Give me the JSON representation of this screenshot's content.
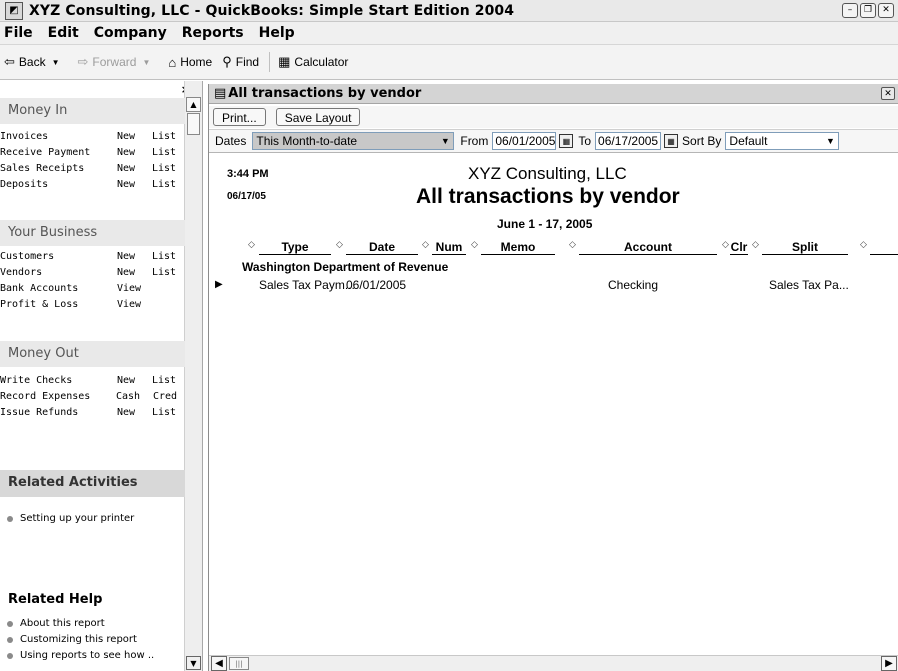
{
  "window": {
    "title": "XYZ Consulting, LLC - QuickBooks: Simple Start Edition 2004"
  },
  "menu": [
    "File",
    "Edit",
    "Company",
    "Reports",
    "Help"
  ],
  "toolbar": {
    "back": "Back",
    "forward": "Forward",
    "home": "Home",
    "find": "Find",
    "calculator": "Calculator"
  },
  "navigator": {
    "money_in": {
      "title": "Money In",
      "rows": [
        {
          "name": "Invoices",
          "a1": "New",
          "a2": "List"
        },
        {
          "name": "Receive Payment",
          "a1": "New",
          "a2": "List"
        },
        {
          "name": "Sales Receipts",
          "a1": "New",
          "a2": "List"
        },
        {
          "name": "Deposits",
          "a1": "New",
          "a2": "List"
        }
      ]
    },
    "your_business": {
      "title": "Your Business",
      "rows": [
        {
          "name": "Customers",
          "a1": "New",
          "a2": "List"
        },
        {
          "name": "Vendors",
          "a1": "New",
          "a2": "List"
        },
        {
          "name": "Bank Accounts",
          "a1": "View"
        },
        {
          "name": "Profit & Loss",
          "a1": "View"
        }
      ]
    },
    "money_out": {
      "title": "Money Out",
      "rows": [
        {
          "name": "Write Checks",
          "a1": "New",
          "a2": "List"
        },
        {
          "name": "Record Expenses",
          "a1": "Cash",
          "a2": "Cred"
        },
        {
          "name": "Issue Refunds",
          "a1": "New",
          "a2": "List"
        }
      ]
    },
    "related_activities": {
      "title": "Related Activities",
      "items": [
        "Setting up your printer"
      ]
    },
    "related_help": {
      "title": "Related Help",
      "items": [
        "About this report",
        "Customizing this report",
        "Using reports to see how .."
      ]
    }
  },
  "report": {
    "window_title": "All transactions by vendor",
    "buttons": {
      "print": "Print...",
      "save_layout": "Save Layout"
    },
    "filters": {
      "dates_label": "Dates",
      "dates_value": "This Month-to-date",
      "from_label": "From",
      "from_value": "06/01/2005",
      "to_label": "To",
      "to_value": "06/17/2005",
      "sort_label": "Sort By",
      "sort_value": "Default"
    },
    "time": "3:44 PM",
    "date": "06/17/05",
    "company": "XYZ Consulting, LLC",
    "name": "All transactions by vendor",
    "range": "June 1 - 17, 2005",
    "columns": [
      "Type",
      "Date",
      "Num",
      "Memo",
      "Account",
      "Clr",
      "Split"
    ],
    "group": "Washington Department of Revenue",
    "rows": [
      {
        "type": "Sales Tax Paym...",
        "date": "06/01/2005",
        "num": "",
        "memo": "",
        "account": "Checking",
        "clr": "",
        "split": "Sales Tax Pa..."
      }
    ]
  }
}
